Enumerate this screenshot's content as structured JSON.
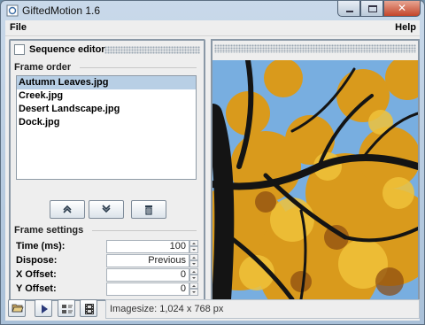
{
  "window": {
    "title": "GiftedMotion 1.6",
    "controls": [
      "minimize-icon",
      "maximize-icon",
      "close-icon"
    ]
  },
  "menubar": {
    "file": "File",
    "help": "Help"
  },
  "sequence_editor": {
    "title": "Sequence editor",
    "frame_order": {
      "title": "Frame order",
      "items": [
        "Autumn Leaves.jpg",
        "Creek.jpg",
        "Desert Landscape.jpg",
        "Dock.jpg"
      ],
      "selected": "Autumn Leaves.jpg"
    },
    "buttons": [
      "move-up-icon",
      "move-down-icon",
      "trash-icon"
    ],
    "frame_settings": {
      "title": "Frame settings",
      "rows": [
        {
          "label": "Time (ms):",
          "value": "100"
        },
        {
          "label": "Dispose:",
          "value": "Previous"
        },
        {
          "label": "X Offset:",
          "value": "0"
        },
        {
          "label": "Y Offset:",
          "value": "0"
        }
      ]
    }
  },
  "toolbar": {
    "buttons": [
      "open-folder-icon",
      "play-icon",
      "settings-icon",
      "filmstrip-icon"
    ]
  },
  "status": {
    "text": "Imagesize: 1,024 x 768 px"
  },
  "colors": {
    "selection": "#b8cfe5",
    "sky": "#6aa0d8",
    "leaves": "#e0a020"
  }
}
